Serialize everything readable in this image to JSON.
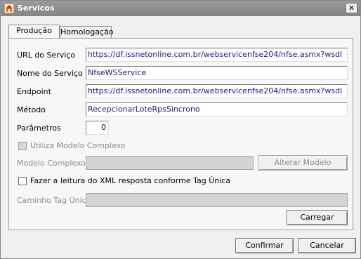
{
  "window": {
    "title": "Servicos",
    "close_label": "✕"
  },
  "tabs": [
    {
      "label": "Produção"
    },
    {
      "label": "Homologação"
    }
  ],
  "form": {
    "url_label": "URL do Serviço",
    "url_value": "https://df.issnetonline.com.br/webservicenfse204/nfse.asmx?wsdl",
    "service_name_label": "Nome do Serviço",
    "service_name_value": "NfseWSService",
    "endpoint_label": "Endpoint",
    "endpoint_value": "https://df.issnetonline.com.br/webservicenfse204/nfse.asmx?wsdl",
    "method_label": "Método",
    "method_value": "RecepcionarLoteRpsSincrono",
    "params_label": "Parâmetros",
    "params_value": "0",
    "complex_model_checkbox_label": "Utiliza Modelo Complexo",
    "complex_model_label": "Modelo Complexo",
    "complex_model_value": "",
    "alter_model_button": "Alterar Modelo",
    "xml_read_checkbox_label": "Fazer a leitura do XML resposta conforme Tag Única",
    "tag_path_label": "Caminho Tag Única",
    "tag_path_value": "",
    "load_button": "Carregar"
  },
  "footer": {
    "confirm_button": "Confirmar",
    "cancel_button": "Cancelar"
  }
}
